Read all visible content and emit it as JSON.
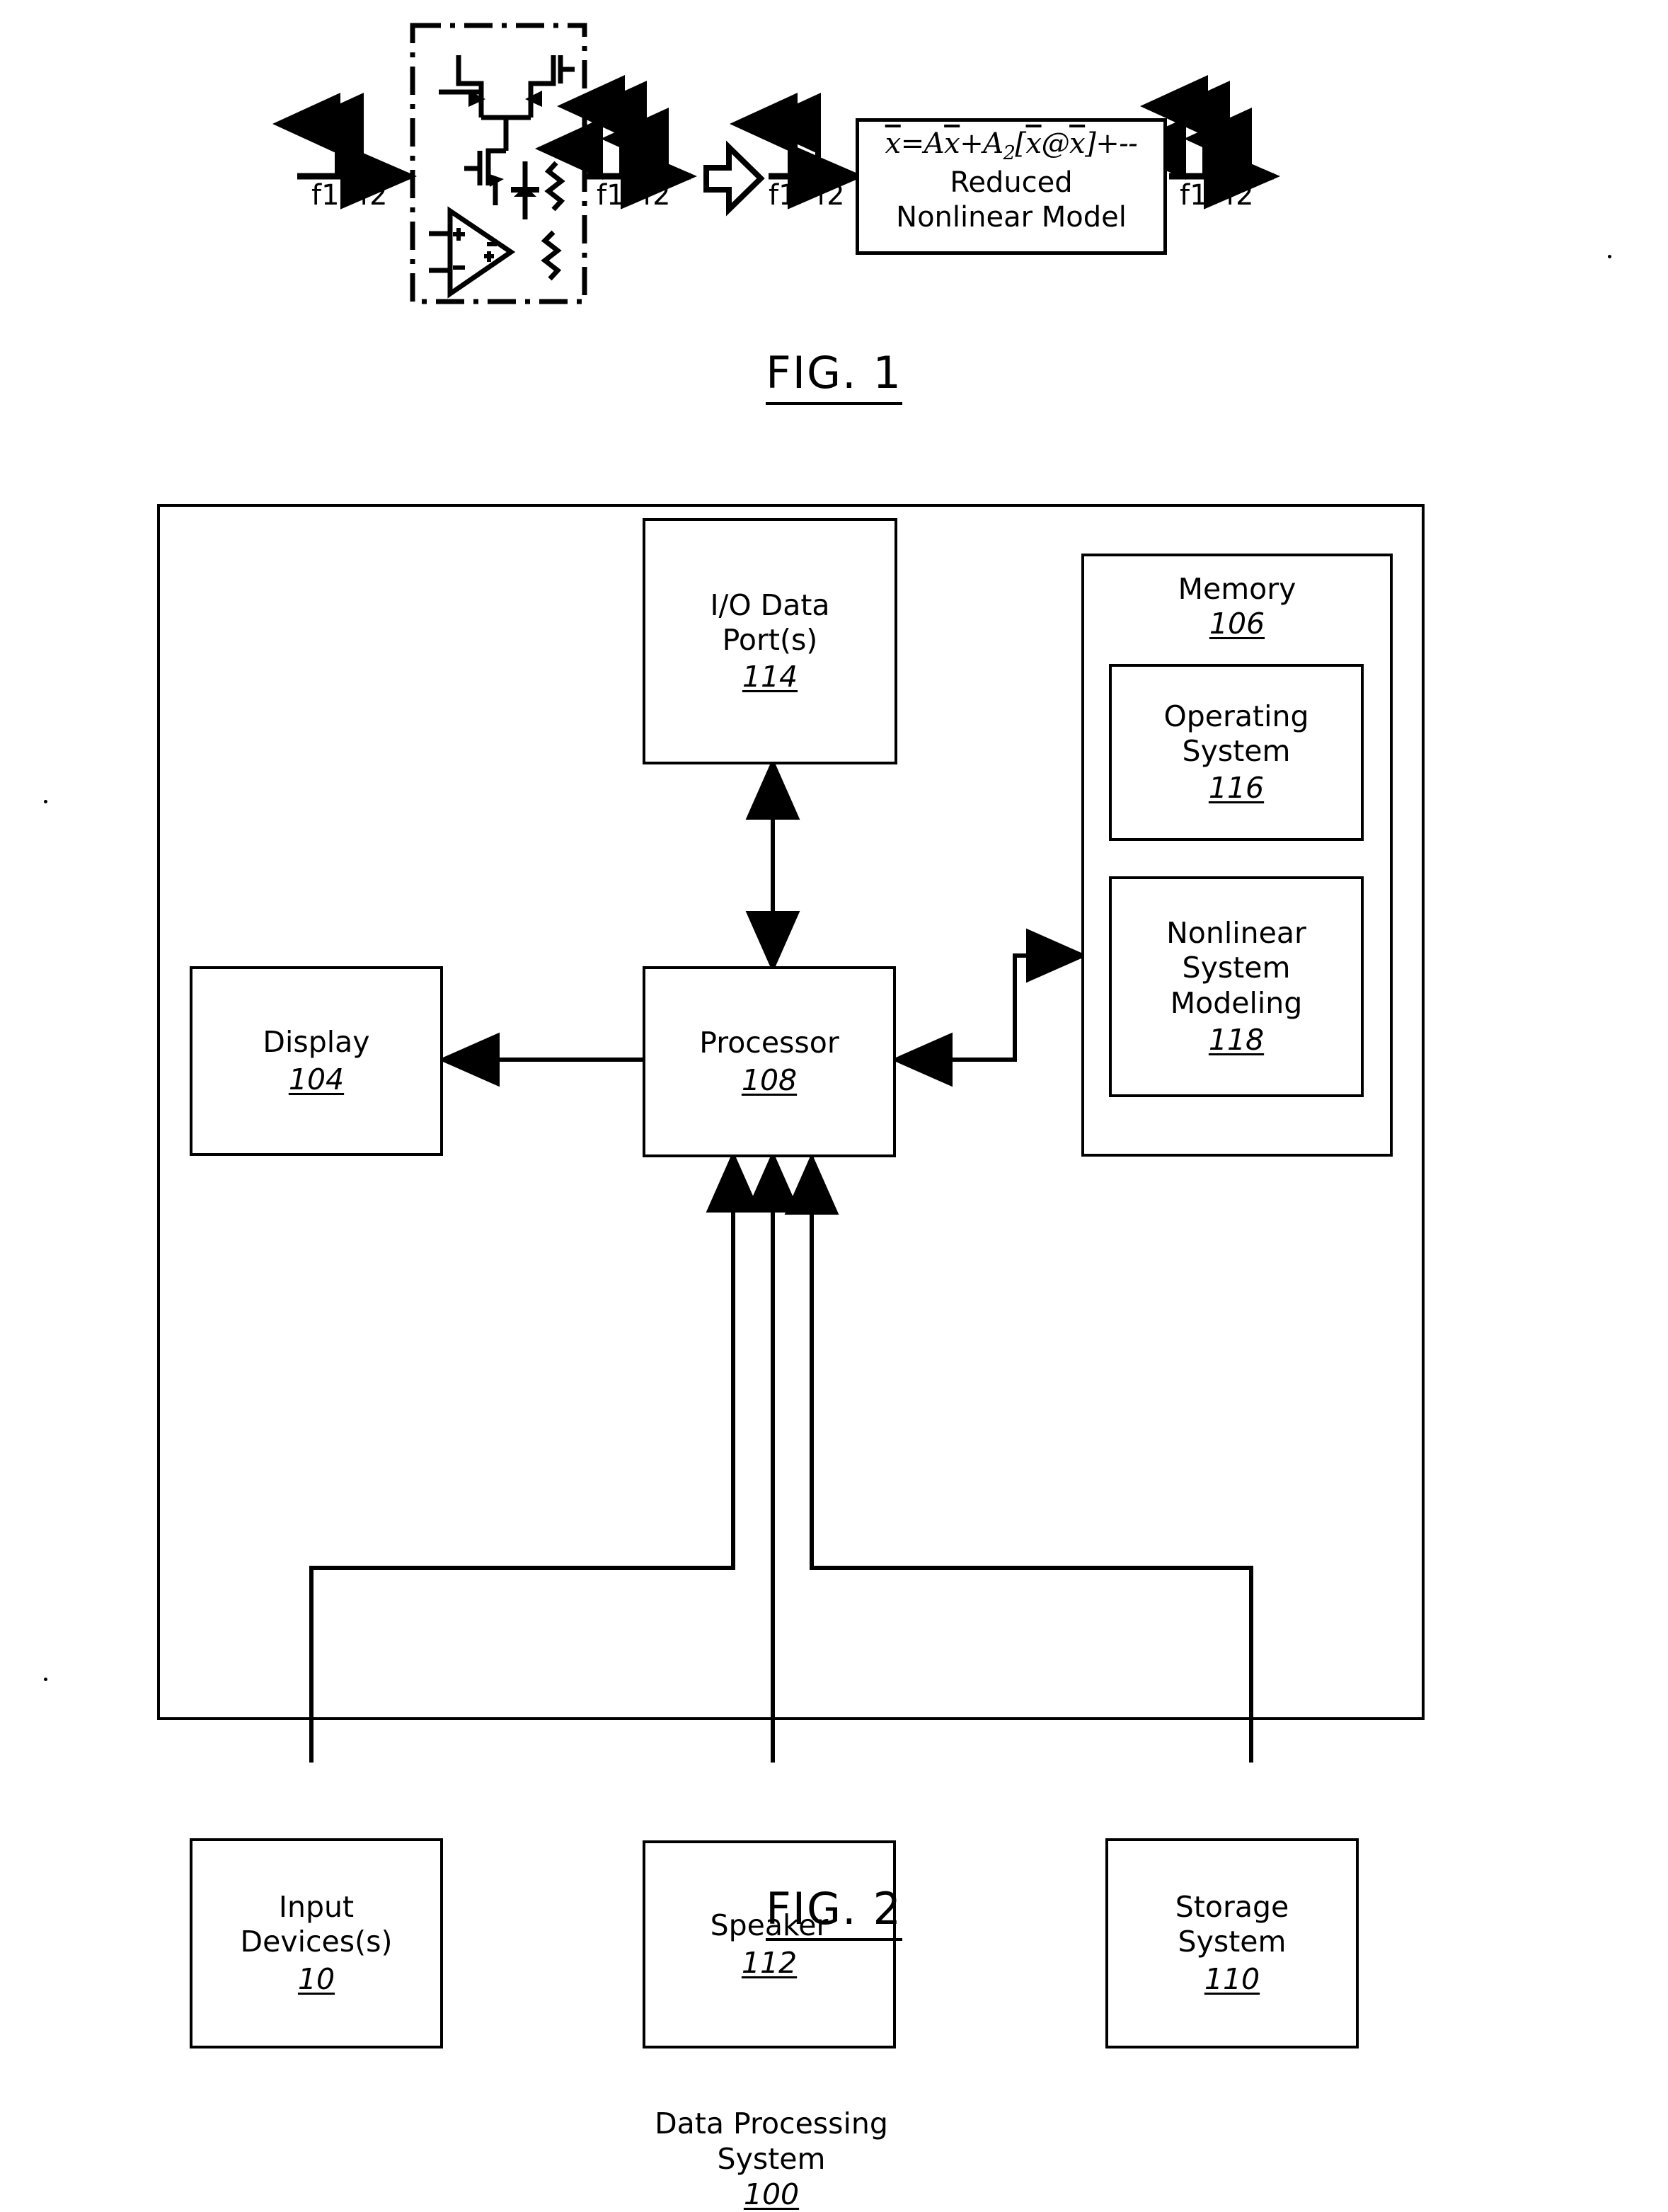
{
  "figures": [
    {
      "id": "fig1",
      "caption": "FIG. 1",
      "description": "Nonlinear circuit spectral distortion and reduced nonlinear model flow",
      "spectra": [
        {
          "name": "input-spectrum",
          "label_f1": "f1",
          "label_f2": "f2",
          "tone_count": 2
        },
        {
          "name": "distorted-spectrum",
          "label_f1": "f1",
          "label_f2": "f2",
          "tone_count": 4
        },
        {
          "name": "model-input-spectrum",
          "label_f1": "f1",
          "label_f2": "f2",
          "tone_count": 2
        },
        {
          "name": "model-output-spectrum",
          "label_f1": "f1",
          "label_f2": "f2",
          "tone_count": 4
        }
      ],
      "circuit_block": {
        "name": "nonlinear-circuit",
        "border_style": "dash-dot",
        "elements": [
          "pmos-transistor",
          "pmos-transistor",
          "nmos-transistor",
          "diode",
          "resistor",
          "op-amp",
          "resistor"
        ]
      },
      "model_box": {
        "equation_plain": "x̄=Ax̄+A2[x̄@x̄]+--",
        "equation_lhs": "x",
        "equation_rhs_1": "=A",
        "equation_rhs_2": "+A",
        "equation_sub": "2",
        "equation_bracket_open": "[",
        "equation_at": "@",
        "equation_bracket_close": "]",
        "equation_tail": "+--",
        "line2": "Reduced",
        "line3": "Nonlinear Model"
      },
      "block_arrow": "hollow-right-arrow"
    },
    {
      "id": "fig2",
      "caption": "FIG. 2",
      "system": {
        "title_line1": "Data Processing",
        "title_line2": "System",
        "number": "100"
      },
      "blocks": [
        {
          "key": "io_data_ports",
          "lines": [
            "I/O Data",
            "Port(s)"
          ],
          "number": "114"
        },
        {
          "key": "display",
          "lines": [
            "Display"
          ],
          "number": "104"
        },
        {
          "key": "processor",
          "lines": [
            "Processor"
          ],
          "number": "108"
        },
        {
          "key": "memory",
          "lines": [
            "Memory"
          ],
          "number": "106"
        },
        {
          "key": "operating_system",
          "lines": [
            "Operating",
            "System"
          ],
          "number": "116"
        },
        {
          "key": "nonlinear_system_modeling",
          "lines": [
            "Nonlinear",
            "System",
            "Modeling"
          ],
          "number": "118"
        },
        {
          "key": "input_devices",
          "lines": [
            "Input",
            "Devices(s)"
          ],
          "number": "10"
        },
        {
          "key": "speaker",
          "lines": [
            "Speaker"
          ],
          "number": "112"
        },
        {
          "key": "storage_system",
          "lines": [
            "Storage",
            "System"
          ],
          "number": "110"
        }
      ],
      "connections": [
        {
          "from": "processor",
          "to": "io_data_ports",
          "type": "bidirectional"
        },
        {
          "from": "processor",
          "to": "display",
          "type": "unidirectional"
        },
        {
          "from": "processor",
          "to": "memory",
          "type": "bidirectional"
        },
        {
          "from": "input_devices",
          "to": "processor",
          "type": "unidirectional"
        },
        {
          "from": "processor",
          "to": "speaker",
          "type": "bidirectional"
        },
        {
          "from": "processor",
          "to": "storage_system",
          "type": "bidirectional"
        }
      ]
    }
  ],
  "blocks_text": {
    "io_data_ports_l1": "I/O Data",
    "io_data_ports_l2": "Port(s)",
    "io_data_ports_num": "114",
    "display_l1": "Display",
    "display_num": "104",
    "processor_l1": "Processor",
    "processor_num": "108",
    "memory_l1": "Memory",
    "memory_num": "106",
    "os_l1": "Operating",
    "os_l2": "System",
    "os_num": "116",
    "nsm_l1": "Nonlinear",
    "nsm_l2": "System",
    "nsm_l3": "Modeling",
    "nsm_num": "118",
    "input_l1": "Input",
    "input_l2": "Devices(s)",
    "input_num": "10",
    "speaker_l1": "Speaker",
    "speaker_num": "112",
    "storage_l1": "Storage",
    "storage_l2": "System",
    "storage_num": "110",
    "dps_l1": "Data Processing",
    "dps_l2": "System",
    "dps_num": "100"
  },
  "fig1_text": {
    "s1_f1": "f1",
    "s1_f2": "f2",
    "s2_f1": "f1",
    "s2_f2": "f2",
    "s3_f1": "f1",
    "s3_f2": "f2",
    "s4_f1": "f1",
    "s4_f2": "f2",
    "eq_x": "x",
    "eq_eqA": "=A",
    "eq_plusA": "+A",
    "eq_two": "2",
    "eq_open": "[",
    "eq_at": "@",
    "eq_close": "]",
    "eq_tail": "+--",
    "model_l2": "Reduced",
    "model_l3": "Nonlinear Model"
  },
  "captions": {
    "fig1": "FIG. 1",
    "fig2": "FIG. 2"
  },
  "colors": {
    "ink": "#000000",
    "paper": "#ffffff"
  }
}
